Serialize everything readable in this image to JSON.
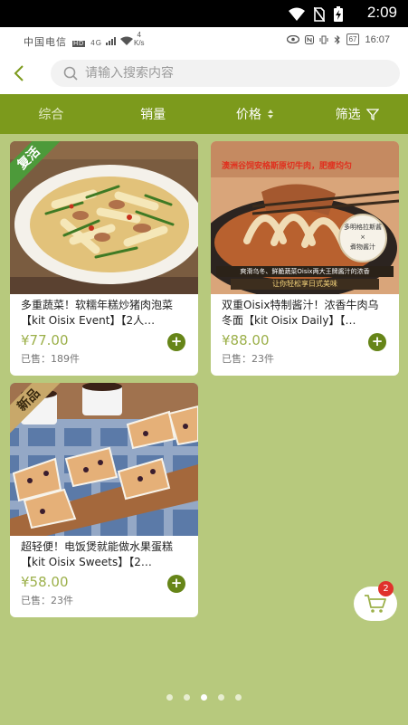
{
  "system_bar": {
    "time": "2:09"
  },
  "phone_status": {
    "carrier": "中国电信",
    "hd": "HD",
    "network": "4G",
    "speed_value": "4",
    "speed_unit": "K/s",
    "battery": "67",
    "time": "16:07"
  },
  "search": {
    "placeholder": "请输入搜索内容"
  },
  "sort_tabs": [
    {
      "label": "综合"
    },
    {
      "label": "销量"
    },
    {
      "label": "价格"
    },
    {
      "label": "筛选"
    }
  ],
  "products": [
    {
      "title": "多重蔬菜！软糯年糕炒猪肉泡菜【kit Oisix Event】【2人…",
      "price": "¥77.00",
      "sold": "已售：189件",
      "tag": "复活"
    },
    {
      "title": "双重Oisix特制酱汁！浓香牛肉乌冬面【kit Oisix Daily】【…",
      "price": "¥88.00",
      "sold": "已售：23件",
      "image_caption_top": "澳洲谷饲安格斯原切牛肉，肥瘦均匀",
      "image_badge_1": "多明格拉斯酱",
      "image_badge_x": "×",
      "image_badge_2": "煮物酱汁",
      "image_caption_bottom": "爽滑乌冬、鲜脆蔬菜Oisix两大王牌酱汁的浓香",
      "image_caption_sub": "让你轻松享日式美味"
    },
    {
      "title": "超轻便！电饭煲就能做水果蛋糕【kit Oisix Sweets】【2…",
      "price": "¥58.00",
      "sold": "已售：23件",
      "tag": "新品"
    }
  ],
  "cart": {
    "count": "2"
  },
  "pager": {
    "count": 5,
    "active": 2
  },
  "colors": {
    "background": "#b7c97d",
    "sortbar": "#7c9a1c",
    "price": "#9cb04a",
    "add_button": "#668518",
    "badge": "#e0312c"
  }
}
